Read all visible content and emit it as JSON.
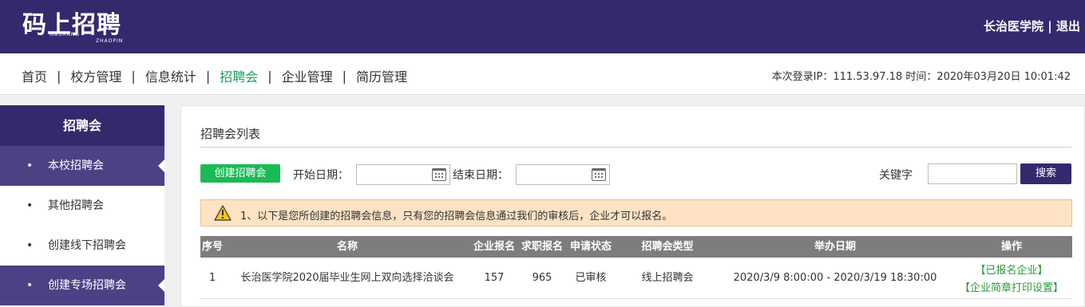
{
  "header": {
    "logo_text": "码上招聘",
    "logo_sub_left": "MASHANG",
    "logo_sub_right": "ZHAOPIN",
    "user": "长治医学院",
    "divider": "|",
    "logout": "退出"
  },
  "nav": {
    "items": [
      "首页",
      "校方管理",
      "信息统计",
      "招聘会",
      "企业管理",
      "简历管理"
    ],
    "active": "招聘会",
    "login_info": "本次登录IP：111.53.97.18 时间：2020年03月20日 10:01:42"
  },
  "sidebar": {
    "title": "招聘会",
    "items": [
      "本校招聘会",
      "其他招聘会",
      "创建线下招聘会",
      "创建专场招聘会"
    ]
  },
  "main": {
    "title": "招聘会列表",
    "create_button": "创建招聘会",
    "start_date_label": "开始日期：",
    "end_date_label": "结束日期：",
    "keyword_label": "关键字",
    "search_button": "搜索",
    "notice": "1、以下是您所创建的招聘会信息，只有您的招聘会信息通过我们的审核后，企业才可以报名。"
  },
  "table": {
    "headers": [
      "序号",
      "名称",
      "企业报名",
      "求职报名",
      "申请状态",
      "招聘会类型",
      "举办日期",
      "操作"
    ],
    "rows": [
      {
        "index": "1",
        "name": "长治医学院2020届毕业生网上双向选择洽谈会",
        "company_signups": "157",
        "job_signups": "965",
        "status": "已审核",
        "type": "线上招聘会",
        "date": "2020/3/9 8:00:00 - 2020/3/19 18:30:00",
        "op1": "【已报名企业】",
        "op2": "【企业简章打印设置】"
      }
    ]
  },
  "colors": {
    "brand": "#35296e",
    "active_nav": "#1aa35a",
    "create_button": "#1aba55",
    "table_header": "#7d7d7d",
    "notice_bg": "#fde3c4"
  }
}
